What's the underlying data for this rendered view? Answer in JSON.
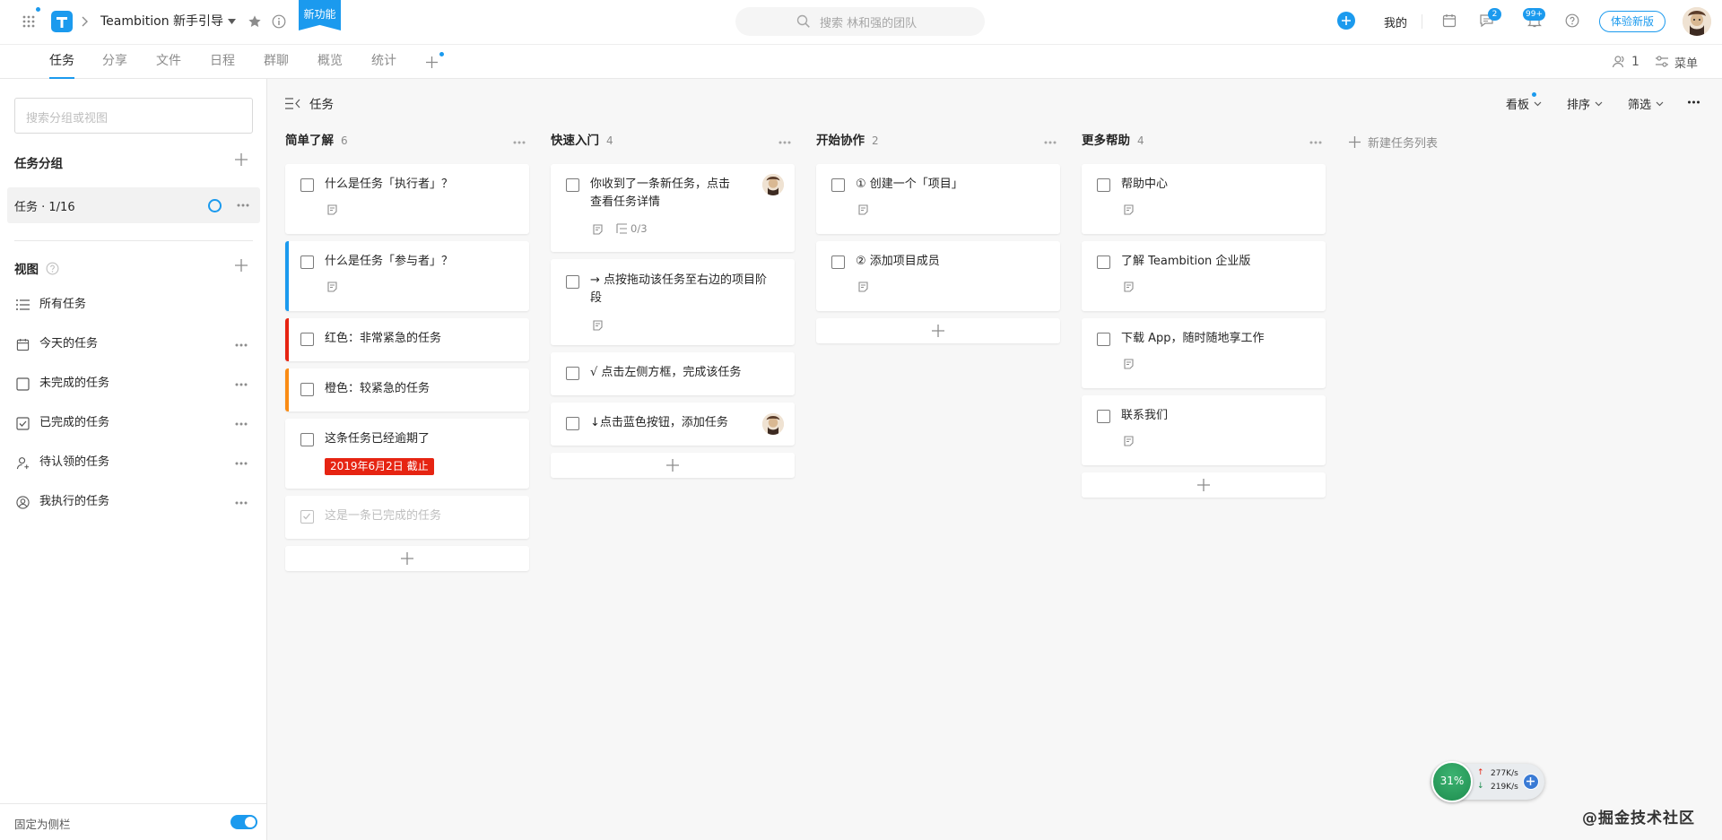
{
  "topbar": {
    "project_name": "Teambition 新手引导",
    "new_feature_badge": "新功能",
    "search_placeholder": "搜索 林和强的团队",
    "my_label": "我的",
    "chat_badge": "2",
    "notify_badge": "99+",
    "trial_button": "体验新版"
  },
  "tabs": [
    {
      "label": "任务",
      "active": true
    },
    {
      "label": "分享"
    },
    {
      "label": "文件"
    },
    {
      "label": "日程"
    },
    {
      "label": "群聊"
    },
    {
      "label": "概览"
    },
    {
      "label": "统计"
    }
  ],
  "tabbar_right": {
    "members_count": "1",
    "menu_label": "菜单"
  },
  "sidebar": {
    "search_placeholder": "搜索分组或视图",
    "groups_title": "任务分组",
    "group_item": "任务 · 1/16",
    "views_title": "视图",
    "views": [
      {
        "label": "所有任务",
        "icon": "list-icon"
      },
      {
        "label": "今天的任务",
        "icon": "calendar-icon"
      },
      {
        "label": "未完成的任务",
        "icon": "checkbox-icon"
      },
      {
        "label": "已完成的任务",
        "icon": "checkbox-checked-icon"
      },
      {
        "label": "待认领的任务",
        "icon": "person-icon"
      },
      {
        "label": "我执行的任务",
        "icon": "user-circle-icon"
      }
    ],
    "pin_label": "固定为侧栏"
  },
  "board": {
    "breadcrumb": "任务",
    "view_label": "看板",
    "sort_label": "排序",
    "filter_label": "筛选",
    "new_list_label": "新建任务列表",
    "columns": [
      {
        "title": "简单了解",
        "count": "6",
        "cards": [
          {
            "text": "什么是任务「执行者」？"
          },
          {
            "text": "什么是任务「参与者」？"
          },
          {
            "text": "红色：非常紧急的任务"
          },
          {
            "text": "橙色：较紧急的任务"
          },
          {
            "text": "这条任务已经逾期了",
            "due": "2019年6月2日 截止"
          },
          {
            "text": "这是一条已完成的任务"
          }
        ]
      },
      {
        "title": "快速入门",
        "count": "4",
        "cards": [
          {
            "line1": "你收到了一条新任务，点击",
            "line2": "查看任务详情",
            "subtasks": "0/3"
          },
          {
            "line1": "→ 点按拖动该任务至右边的项目阶",
            "line2": "段"
          },
          {
            "text": "√  点击左侧方框，完成该任务"
          },
          {
            "text": "↓点击蓝色按钮，添加任务"
          }
        ]
      },
      {
        "title": "开始协作",
        "count": "2",
        "cards": [
          {
            "text": "① 创建一个「项目」"
          },
          {
            "text": "② 添加项目成员"
          }
        ]
      },
      {
        "title": "更多帮助",
        "count": "4",
        "cards": [
          {
            "text": "帮助中心"
          },
          {
            "text": "了解 Teambition 企业版"
          },
          {
            "text": "下载 App，随时随地享工作"
          },
          {
            "text": "联系我们"
          }
        ]
      }
    ]
  },
  "netmon": {
    "percent": "31%",
    "up": "277K/s",
    "down": "219K/s"
  },
  "watermark": "@掘金技术社区",
  "colors": {
    "accent": "#1b9aee",
    "urgent": "#e62412",
    "warning": "#fa8c15",
    "due_badge": "#e62412"
  }
}
